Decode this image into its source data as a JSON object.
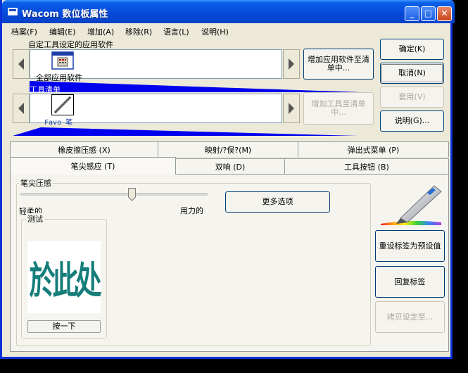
{
  "window": {
    "title": "Wacom 数位板属性"
  },
  "titlebar_buttons": {
    "minimize": "_",
    "maximize": "□",
    "close": "✕"
  },
  "menu": [
    "档案(F)",
    "编辑(E)",
    "增加(A)",
    "移除(R)",
    "语言(L)",
    "说明(H)"
  ],
  "apps": {
    "label": "自定工具设定的应用软件",
    "item_label": "全部应用软件",
    "add_button": "增加应用软件至清单中..."
  },
  "tools": {
    "label": "工具清单",
    "item_label": "Favo 笔",
    "add_button": "增加工具至清单中..."
  },
  "side_buttons": {
    "ok": "确定(K)",
    "cancel": "取消(N)",
    "apply": "套用(V)",
    "help": "说明(G)..."
  },
  "tabs_row1": [
    "橡皮擦压感 (X)",
    "映射/?俣?(M)",
    "弹出式菜单 (P)"
  ],
  "tabs_row2": [
    "笔尖感应 (T)",
    "双响 (D)",
    "工具按钮 (B)"
  ],
  "tip_feel": {
    "group_title": "笔尖压感",
    "soft_label": "轻柔的",
    "firm_label": "用力的",
    "more_options": "更多选项",
    "test_title": "测试",
    "test_text": "於此处",
    "test_button": "按一下",
    "slider_value_percent": 60
  },
  "right_buttons": {
    "reset": "重设标签为预设值",
    "restore": "回复标签",
    "copy": "拷贝设定至..."
  },
  "colors": {
    "title_blue": "#0549d8",
    "accent_blue": "#0000ee",
    "test_text": "#157d7a"
  }
}
